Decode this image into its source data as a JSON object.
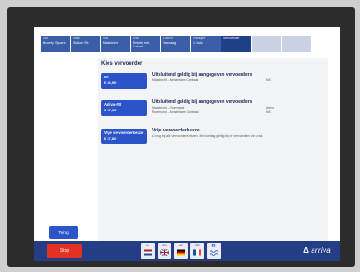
{
  "steps": [
    {
      "label": "Van",
      "value": "Beverly Square"
    },
    {
      "label": "Naar",
      "value": "Station Sitt."
    },
    {
      "label": "Via",
      "value": "Maastricht"
    },
    {
      "label": "Reis",
      "value": "Enkele reis, Lokaal"
    },
    {
      "label": "Datum",
      "value": "Vandaag"
    },
    {
      "label": "Reiziger",
      "value": "1 Volw."
    },
    {
      "label": "",
      "value": "Vervoerder"
    },
    {
      "label": "",
      "value": ""
    },
    {
      "label": "",
      "value": ""
    }
  ],
  "panel": {
    "title": "Kies vervoerder",
    "options": [
      {
        "button_name": "NS",
        "button_price": "€ 36,90",
        "heading": "Uitsluitend geldig bij aangegeven vervoerders",
        "lines": [
          "Maastricht – Amsterdam Centraal",
          "NS"
        ]
      },
      {
        "button_name": "Arriva-NS",
        "button_price": "€ 37,35",
        "heading": "Uitsluitend geldig bij aangegeven vervoerders",
        "lines": [
          "Maastricht – Roermond",
          "Arriva",
          "Roermond – Amsterdam Centraal",
          "NS"
        ]
      },
      {
        "button_name": "Vrije vervoerderkeuze",
        "button_price": "€ 37,80",
        "heading": "Vrije vervoerderkeuze",
        "lines": [
          "U mag bij alle vervoerders reizen. Een toeslag geldig bij de vervoerders die u wilt."
        ]
      }
    ]
  },
  "back_label": "Terug",
  "stop_label": "Stop",
  "languages": [
    {
      "code": "NL"
    },
    {
      "code": "EN"
    },
    {
      "code": "DE"
    },
    {
      "code": "FR"
    },
    {
      "code": "♿"
    }
  ],
  "logo": {
    "text": "arriva"
  },
  "colors": {
    "accent": "#2a54c8",
    "bar": "#243e86",
    "stop": "#e43222"
  }
}
